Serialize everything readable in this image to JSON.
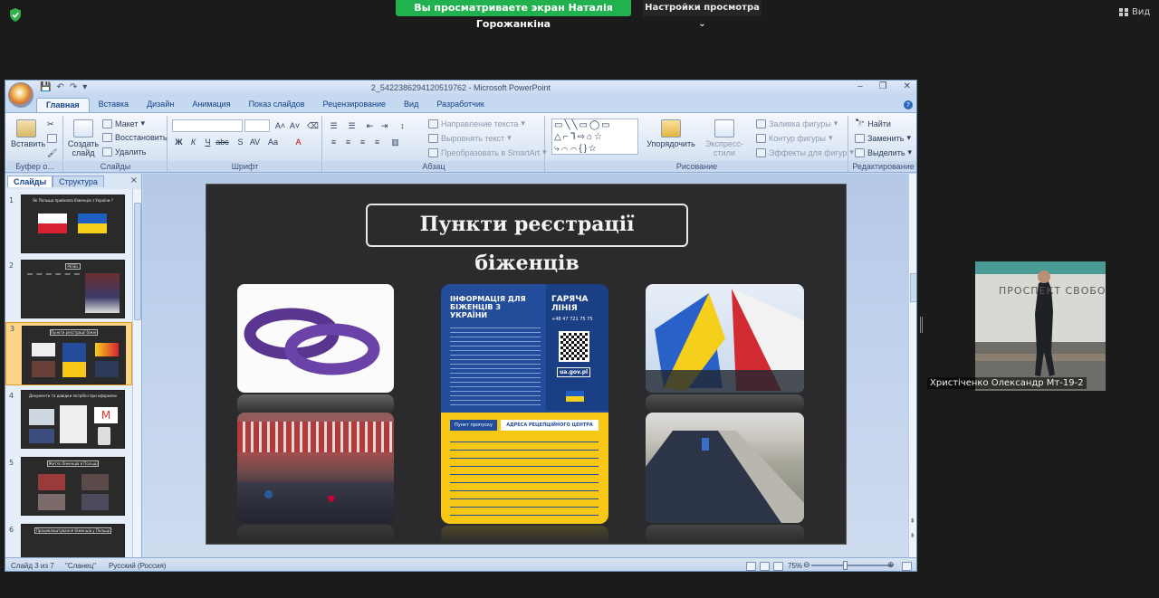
{
  "zoom": {
    "banner": "Вы просматриваете экран Наталія Горожанкіна",
    "view_options": "Настройки просмотра",
    "view_button": "Вид"
  },
  "window": {
    "title": "2_5422386294120519762 - Microsoft PowerPoint",
    "controls": [
      "–",
      "❐",
      "✕"
    ]
  },
  "ribbon": {
    "tabs": [
      "Главная",
      "Вставка",
      "Дизайн",
      "Анимация",
      "Показ слайдов",
      "Рецензирование",
      "Вид",
      "Разработчик"
    ],
    "clipboard": {
      "paste": "Вставить",
      "label": "Буфер о..."
    },
    "slides": {
      "new_slide": "Создать слайд",
      "layout": "Макет",
      "reset": "Восстановить",
      "delete": "Удалить",
      "label": "Слайды"
    },
    "font": {
      "label": "Шрифт"
    },
    "paragraph": {
      "text_direction": "Направление текста",
      "align_text": "Выровнять текст",
      "smartart": "Преобразовать в SmartArt",
      "label": "Абзац"
    },
    "drawing": {
      "arrange": "Упорядочить",
      "quick_styles": "Экспресс-стили",
      "fill": "Заливка фигуры",
      "outline": "Контур фигуры",
      "effects": "Эффекты для фигур",
      "label": "Рисование"
    },
    "editing": {
      "find": "Найти",
      "replace": "Заменить",
      "select": "Выделить",
      "label": "Редактирование"
    }
  },
  "panel": {
    "tabs": [
      "Слайды",
      "Структура"
    ],
    "close": "×",
    "thumbnails": [
      {
        "num": "1",
        "title": "Як Польща прийняла біженців з України ?"
      },
      {
        "num": "2",
        "title": "PESEL"
      },
      {
        "num": "3",
        "title": "Пункти реєстрації біженців"
      },
      {
        "num": "4",
        "title": "Документи та довідки потрібні при оформленні статусу біженця"
      },
      {
        "num": "5",
        "title": "Житло біженців в Польщі"
      },
      {
        "num": "6",
        "title": "Працевлаштування біженців у Польщі"
      }
    ]
  },
  "slide": {
    "title": "Пункти реєстрації біженців",
    "poster": {
      "heading": "ІНФОРМАЦІЯ ДЛЯ БІЖЕНЦІВ З УКРАЇНИ",
      "hotline": "ГАРЯЧА ЛІНІЯ",
      "phone": "+48 47 721 75 75",
      "site": "ua.gov.pl",
      "col1": "Пункт пропуску",
      "col2": "АДРЕСА РЕЦЕПЦІЙНОГО ЦЕНТРА"
    }
  },
  "status": {
    "slide_of": "Слайд 3 из 7",
    "theme": "\"Сланец\"",
    "language": "Русский (Россия)",
    "zoom": "75%"
  },
  "participant": {
    "name": "Христіченко Олександр Мт-19-2",
    "sign_text": "ПРОСПЕКТ СВОБО"
  },
  "colors": {
    "banner": "#21b24f",
    "ribbon": "#dbe6f4",
    "slide_bg": "#2b2b2d",
    "selected_thumb": "#fbd587",
    "poster_blue": "#234d9a",
    "poster_yellow": "#f6c815"
  }
}
